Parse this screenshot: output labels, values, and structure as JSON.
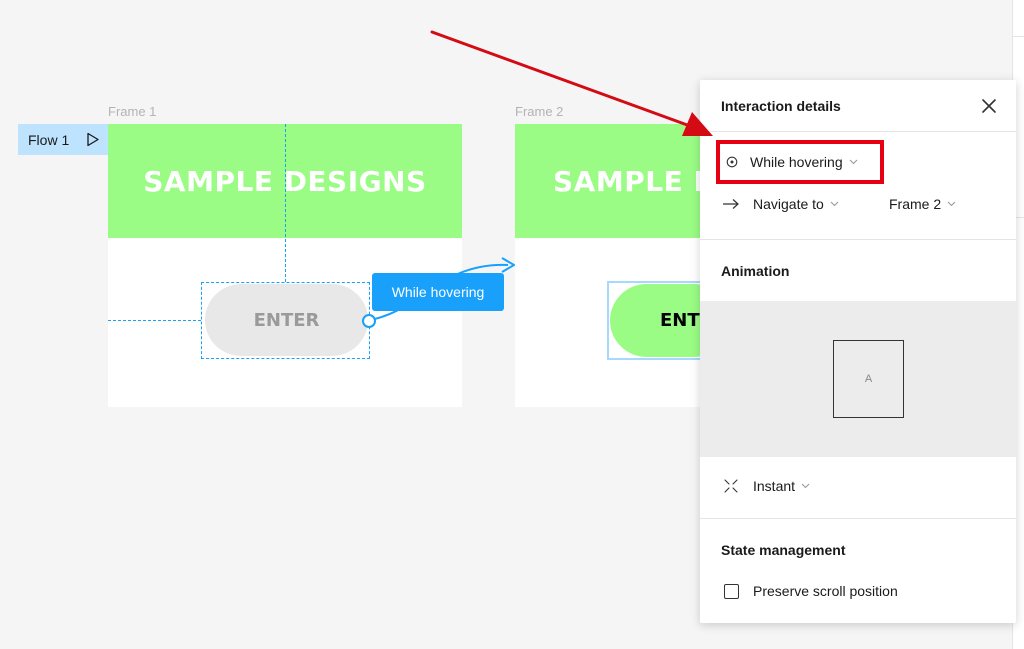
{
  "canvas": {
    "frames": [
      {
        "label": "Frame 1",
        "banner_text": "SAMPLE DESIGNS",
        "button_text": "ENTER"
      },
      {
        "label": "Frame 2",
        "banner_text": "SAMPLE D",
        "button_text": "ENT"
      }
    ],
    "flow": {
      "label": "Flow 1"
    },
    "interaction_chip": "While hovering"
  },
  "panel": {
    "title": "Interaction details",
    "trigger": {
      "icon": "hover-circle-icon",
      "label": "While hovering"
    },
    "action": {
      "icon": "arrow-right-icon",
      "label": "Navigate to",
      "destination": "Frame 2"
    },
    "animation": {
      "title": "Animation",
      "preview_label": "A",
      "type": "Instant",
      "type_icon": "instant-icon"
    },
    "state": {
      "title": "State management",
      "checkbox_label": "Preserve scroll position",
      "checked": false
    }
  },
  "colors": {
    "accent": "#18a0fb",
    "banner_green": "#9bfc85",
    "highlight_red": "#e60012",
    "flow_tag": "#bde3ff"
  }
}
